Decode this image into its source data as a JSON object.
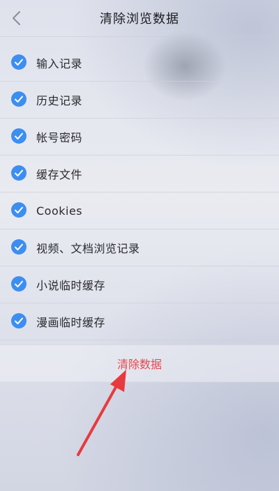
{
  "header": {
    "title": "清除浏览数据",
    "back_icon": "chevron-left-icon"
  },
  "options": [
    {
      "label": "输入记录",
      "checked": true
    },
    {
      "label": "历史记录",
      "checked": true
    },
    {
      "label": "帐号密码",
      "checked": true
    },
    {
      "label": "缓存文件",
      "checked": true
    },
    {
      "label": "Cookies",
      "checked": true
    },
    {
      "label": "视频、文档浏览记录",
      "checked": true
    },
    {
      "label": "小说临时缓存",
      "checked": true
    },
    {
      "label": "漫画临时缓存",
      "checked": true
    }
  ],
  "action": {
    "clear_label": "清除数据"
  },
  "colors": {
    "check": "#3d8ef0",
    "clear_text": "#e5484d",
    "arrow": "#e8393f"
  }
}
